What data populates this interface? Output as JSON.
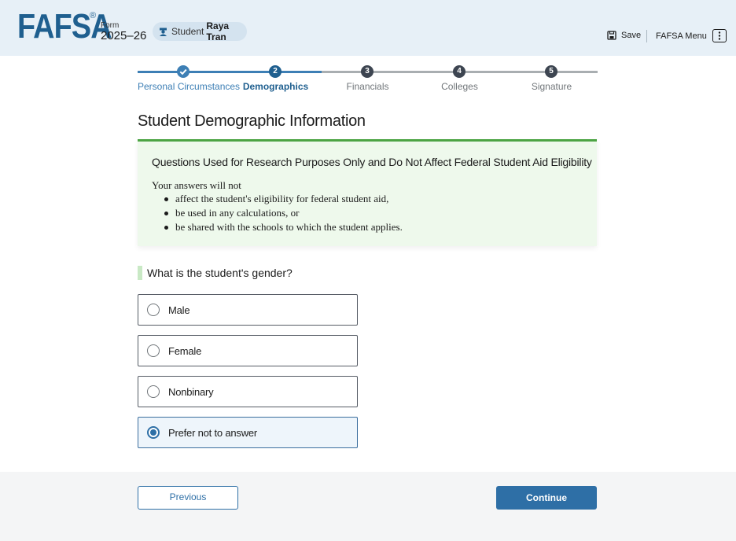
{
  "header": {
    "logo": "FAFSA",
    "logo_mark": "®",
    "form_label": "Form",
    "form_year": "2025–26",
    "student_label": "Student",
    "student_name": "Raya Tran",
    "save_label": "Save",
    "menu_label": "FAFSA Menu"
  },
  "stepper": {
    "steps": [
      {
        "number": "1",
        "label": "Personal Circumstances",
        "status": "complete"
      },
      {
        "number": "2",
        "label": "Demographics",
        "status": "current"
      },
      {
        "number": "3",
        "label": "Financials",
        "status": "upcoming"
      },
      {
        "number": "4",
        "label": "Colleges",
        "status": "upcoming"
      },
      {
        "number": "5",
        "label": "Signature",
        "status": "upcoming"
      }
    ]
  },
  "page_title": "Student Demographic Information",
  "info_box": {
    "title": "Questions Used for Research Purposes Only and Do Not Affect Federal Student Aid Eligibility",
    "intro": "Your answers will not",
    "items": [
      "affect the student's eligibility for federal student aid,",
      "be used in any calculations, or",
      "be shared with the schools to which the student applies."
    ]
  },
  "question": {
    "text": "What is the student's gender?",
    "options": [
      {
        "label": "Male",
        "selected": false
      },
      {
        "label": "Female",
        "selected": false
      },
      {
        "label": "Nonbinary",
        "selected": false
      },
      {
        "label": "Prefer not to answer",
        "selected": true
      }
    ]
  },
  "footer": {
    "previous_label": "Previous",
    "continue_label": "Continue"
  },
  "colors": {
    "header_bg": "#e7f0f7",
    "brand_blue": "#1f5f8f",
    "primary_button": "#2e6fa6",
    "info_border": "#4ca444",
    "info_bg": "#eef9ec",
    "step_upcoming": "#3d4551"
  }
}
